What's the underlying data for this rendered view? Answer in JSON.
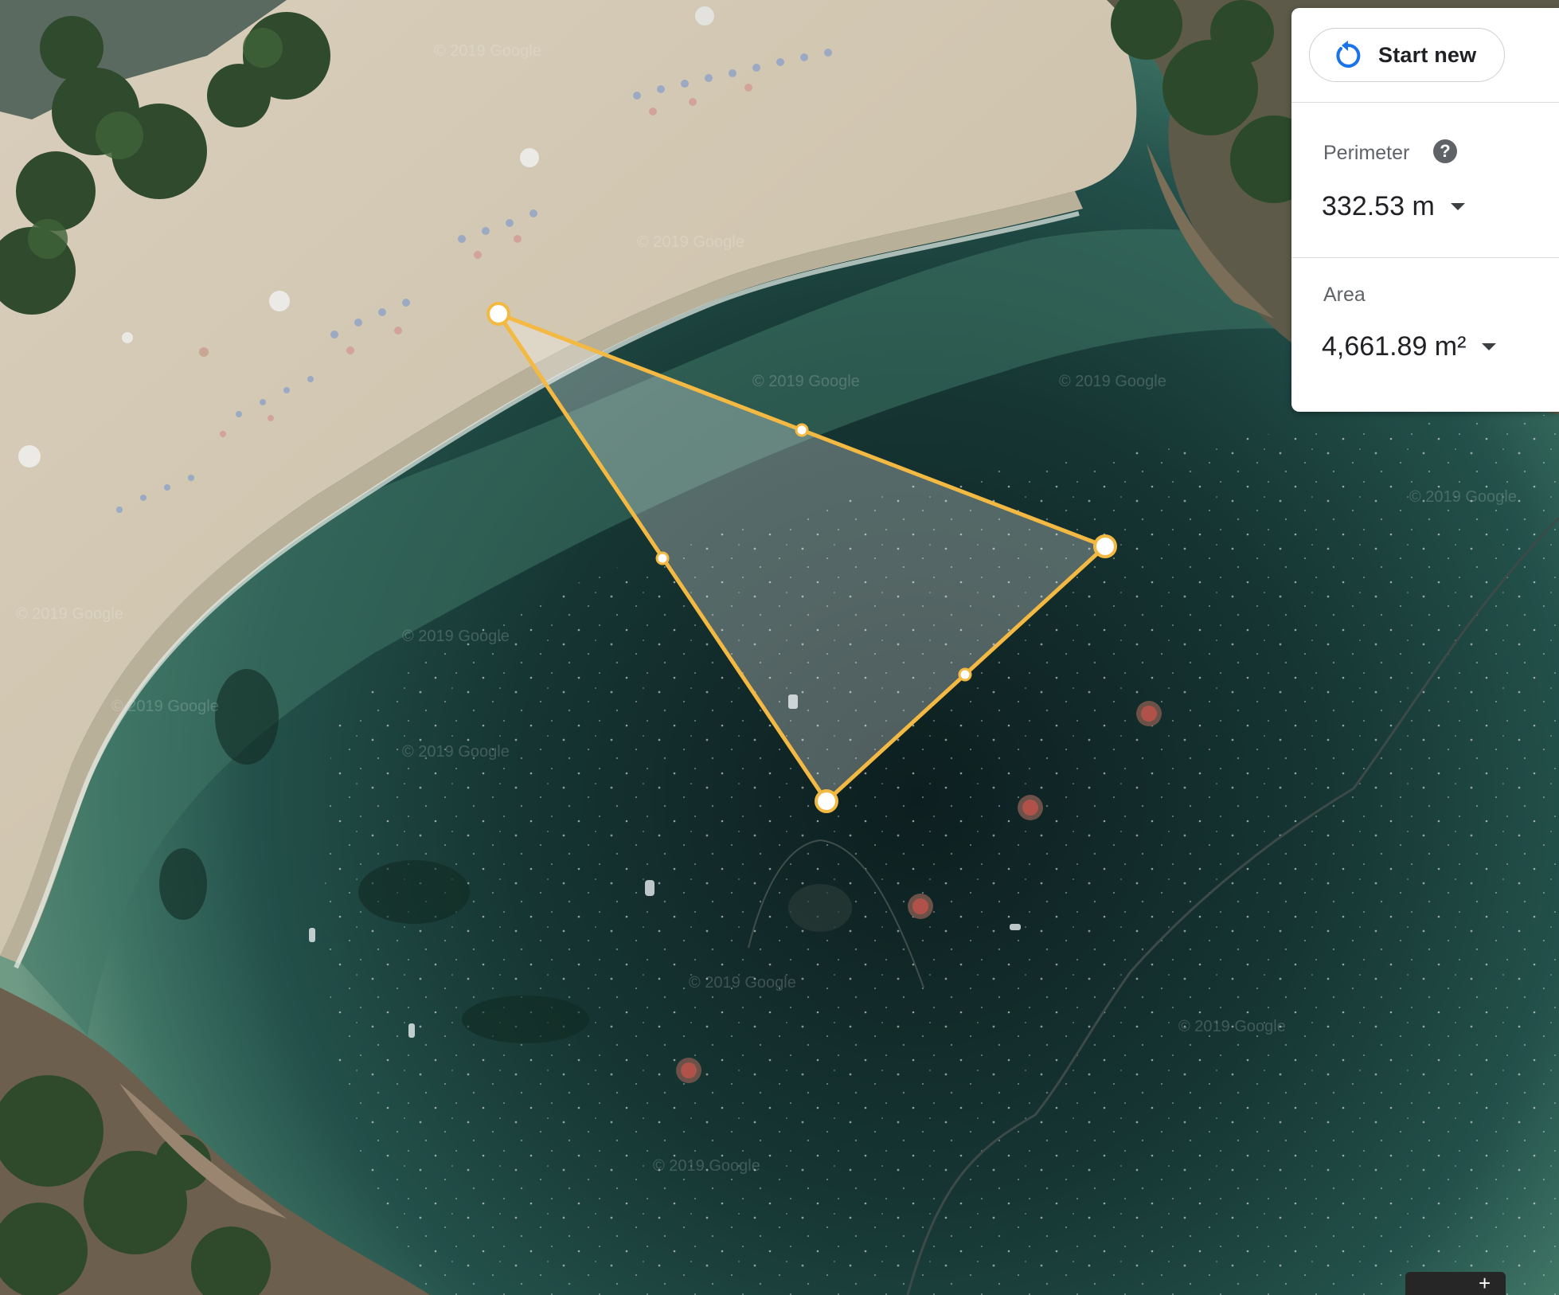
{
  "measure_panel": {
    "start_new_label": "Start new",
    "perimeter_label": "Perimeter",
    "perimeter_value": "332.53 m",
    "area_label": "Area",
    "area_value": "4,661.89 m²",
    "help_symbol": "?"
  },
  "map": {
    "imagery": "satellite",
    "watermark": "© 2019 Google",
    "measure_color": "#f4b942",
    "icons": {
      "start_new": "refresh-icon",
      "help": "help-circle-icon",
      "dropdown": "caret-down-icon"
    }
  },
  "bottom_control": {
    "symbol": "+"
  }
}
